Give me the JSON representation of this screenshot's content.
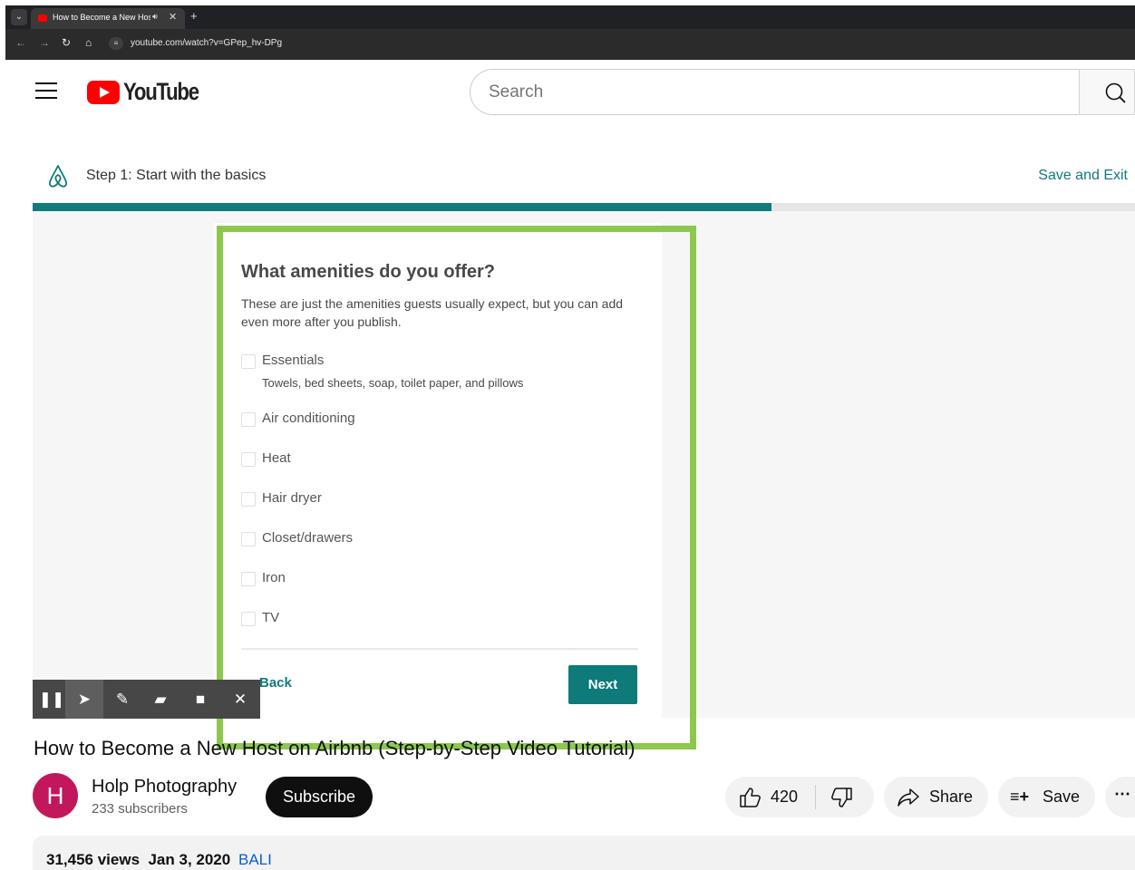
{
  "browser": {
    "tab_title": "How to Become a New Host on Airbnb (Step-by-Step Video Tutorial)",
    "url": "youtube.com/watch?v=GPep_hv-DPg"
  },
  "header": {
    "logo_text": "YouTube",
    "search_placeholder": "Search"
  },
  "video": {
    "step_title": "Step 1: Start with the basics",
    "save_exit_label": "Save and Exit",
    "progress_percent": 67,
    "question_title": "What amenities do you offer?",
    "question_subtitle": "These are just the amenities guests usually expect, but you can add even more after you publish.",
    "amenities": [
      {
        "label": "Essentials",
        "description": "Towels, bed sheets, soap, toilet paper, and pillows"
      },
      {
        "label": "Air conditioning"
      },
      {
        "label": "Heat"
      },
      {
        "label": "Hair dryer"
      },
      {
        "label": "Closet/drawers"
      },
      {
        "label": "Iron"
      },
      {
        "label": "TV"
      }
    ],
    "back_label": "Back",
    "next_label": "Next",
    "highlight_color": "#8cc84b",
    "accent_color": "#117a7a"
  },
  "annotation_toolbar": {
    "tools": [
      "pause-icon",
      "cursor-icon",
      "pen-icon",
      "highlighter-icon",
      "camera-icon",
      "close-icon"
    ]
  },
  "meta": {
    "title": "How to Become a New Host on Airbnb (Step-by-Step Video Tutorial)",
    "channel_name": "Holp Photography",
    "channel_initial": "H",
    "subscribers": "233 subscribers",
    "subscribe_label": "Subscribe",
    "like_count": "420",
    "share_label": "Share",
    "save_label": "Save",
    "views_date": "31,456 views  Jan 3, 2020",
    "tag": "BALI"
  }
}
